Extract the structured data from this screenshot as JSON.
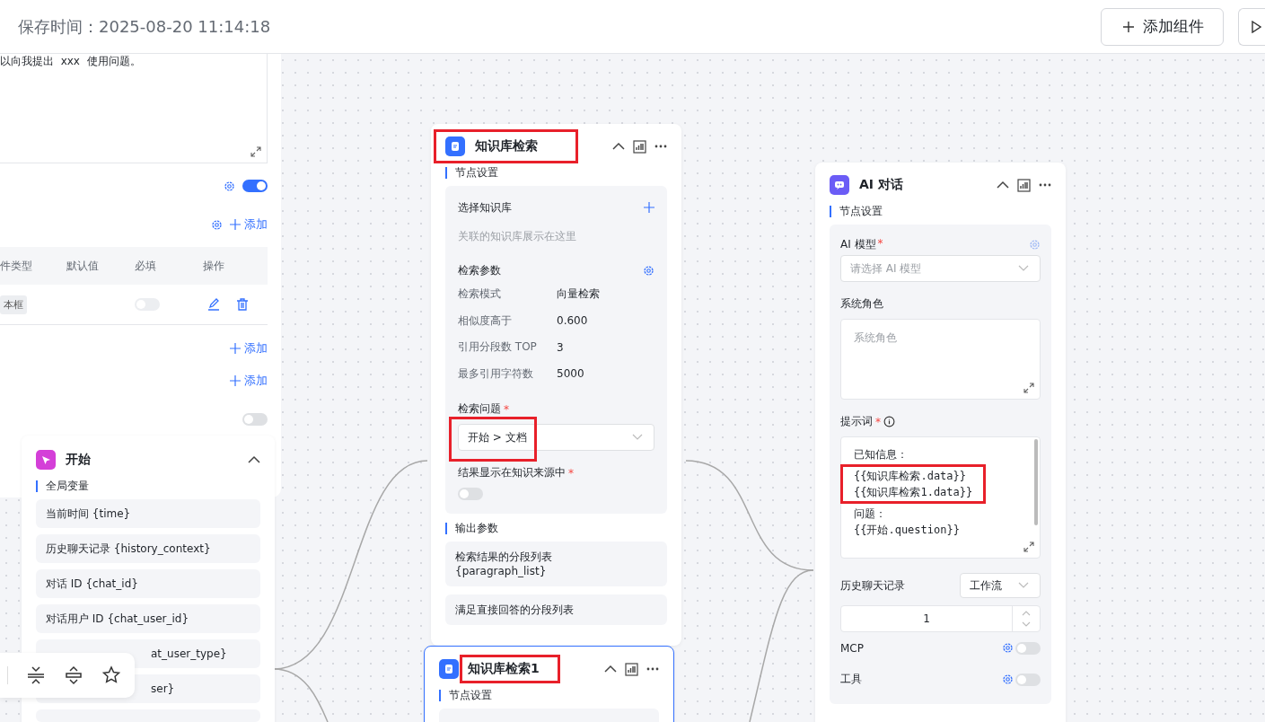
{
  "header": {
    "save_time": "保存时间：2025-08-20 11:14:18",
    "add_component_button": "添加组件"
  },
  "settings_panel": {
    "opening_text": "以向我提出  xxx  使用问题。",
    "rows": [
      {
        "kind": "settings_toggle",
        "on": true
      },
      {
        "kind": "settings_add",
        "label": "添加"
      },
      {
        "kind": "table",
        "columns": [
          "件类型",
          "默认值",
          "必填",
          "操作"
        ],
        "rows": [
          {
            "type": "本框",
            "required": false
          }
        ]
      },
      {
        "kind": "add",
        "label": "添加"
      },
      {
        "kind": "add",
        "label": "添加"
      },
      {
        "kind": "toggle",
        "on": false
      }
    ]
  },
  "start_node": {
    "title": "开始",
    "section": "全局变量",
    "variables": [
      {
        "kind": "full",
        "text": "当前时间 {time}"
      },
      {
        "kind": "full",
        "text": "历史聊天记录 {history_context}"
      },
      {
        "kind": "full",
        "text": "对话 ID {chat_id}"
      },
      {
        "kind": "full",
        "text": "对话用户 ID {chat_user_id}"
      },
      {
        "kind": "covered",
        "text": "at_user_type}"
      },
      {
        "kind": "covered",
        "text": "ser}"
      },
      {
        "kind": "empty"
      }
    ]
  },
  "knowledge_node": {
    "title": "知识库检索",
    "highlighted": true,
    "section": "节点设置",
    "kb_label": "选择知识库",
    "kb_placeholder": "关联的知识库展示在这里",
    "params_label": "检索参数",
    "params": [
      {
        "label": "检索模式",
        "value": "向量检索"
      },
      {
        "label": "相似度高于",
        "value": "0.600"
      },
      {
        "label": "引用分段数 TOP",
        "value": "3"
      },
      {
        "label": "最多引用字符数",
        "value": "5000"
      }
    ],
    "question_label": "检索问题",
    "question_required": "*",
    "question_value": "开始 > 文档",
    "question_highlighted": true,
    "show_source_label": "结果显示在知识来源中",
    "show_source_required": "*",
    "show_source_on": false,
    "output_section": "输出参数",
    "outputs": [
      "检索结果的分段列表\n{paragraph_list}",
      "满足直接回答的分段列表"
    ]
  },
  "knowledge_node_2": {
    "title": "知识库检索1",
    "highlighted": true,
    "selected": true,
    "section": "节点设置"
  },
  "ai_node": {
    "title": "AI 对话",
    "section": "节点设置",
    "model_label": "AI 模型",
    "model_required": "*",
    "model_placeholder": "请选择 AI 模型",
    "role_label": "系统角色",
    "role_placeholder": "系统角色",
    "prompt_label": "提示词",
    "prompt_required": "*",
    "prompt_lines": [
      {
        "text": "已知信息：",
        "highlighted": false
      },
      {
        "text": "{{知识库检索.data}}",
        "highlighted": true
      },
      {
        "text": "{{知识库检索1.data}}",
        "highlighted": true
      },
      {
        "text": "问题：",
        "highlighted": false
      },
      {
        "text": "{{开始.question}}",
        "highlighted": false
      }
    ],
    "history_label": "历史聊天记录",
    "history_value": "工作流",
    "history_count": "1",
    "switches": [
      {
        "label": "MCP",
        "on": false
      },
      {
        "label": "工具",
        "on": false
      }
    ]
  }
}
